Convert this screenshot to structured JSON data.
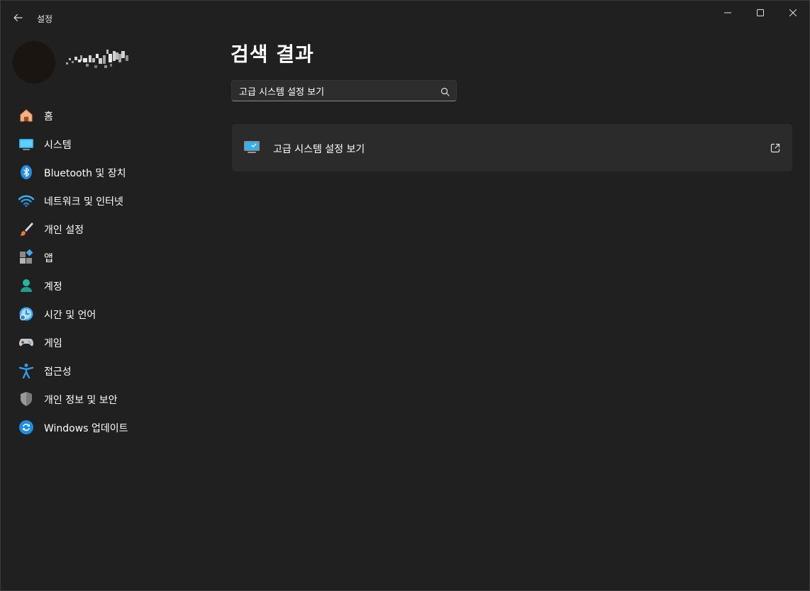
{
  "window": {
    "title": "설정"
  },
  "profile": {
    "user_name_obscured": true
  },
  "sidebar": {
    "items": [
      {
        "label": "홈",
        "icon": "home-icon"
      },
      {
        "label": "시스템",
        "icon": "system-icon"
      },
      {
        "label": "Bluetooth 및 장치",
        "icon": "bluetooth-icon"
      },
      {
        "label": "네트워크 및 인터넷",
        "icon": "wifi-icon"
      },
      {
        "label": "개인 설정",
        "icon": "brush-icon"
      },
      {
        "label": "앱",
        "icon": "apps-icon"
      },
      {
        "label": "계정",
        "icon": "account-icon"
      },
      {
        "label": "시간 및 언어",
        "icon": "time-language-icon"
      },
      {
        "label": "게임",
        "icon": "gamepad-icon"
      },
      {
        "label": "접근성",
        "icon": "accessibility-icon"
      },
      {
        "label": "개인 정보 및 보안",
        "icon": "shield-icon"
      },
      {
        "label": "Windows 업데이트",
        "icon": "update-icon"
      }
    ]
  },
  "main": {
    "title": "검색 결과",
    "search": {
      "value": "고급 시스템 설정 보기"
    },
    "results": [
      {
        "label": "고급 시스템 설정 보기",
        "icon": "monitor-icon",
        "action_icon": "external-link-icon"
      }
    ]
  },
  "colors": {
    "background": "#202020",
    "card": "#2b2b2b",
    "accent": "#4cc2ff"
  }
}
